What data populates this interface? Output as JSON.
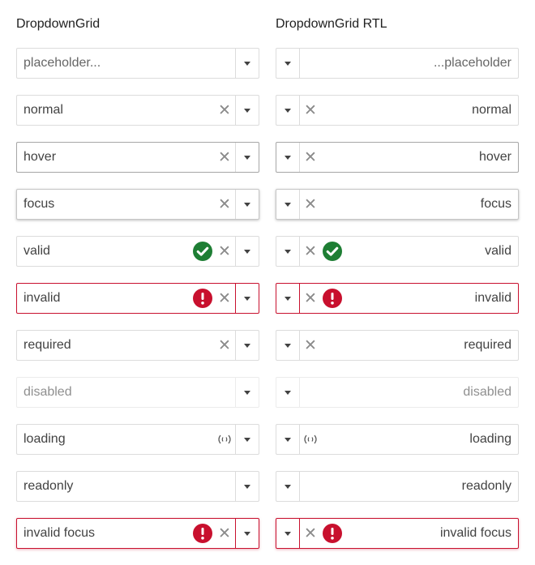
{
  "columns": {
    "ltr": {
      "title": "DropdownGrid"
    },
    "rtl": {
      "title": "DropdownGrid RTL"
    }
  },
  "rows": [
    {
      "label": "placeholder...",
      "rtl_label": "...placeholder",
      "state": "placeholder",
      "clear": false,
      "status": null
    },
    {
      "label": "normal",
      "state": "normal",
      "clear": true,
      "status": null
    },
    {
      "label": "hover",
      "state": "hover",
      "clear": true,
      "status": null
    },
    {
      "label": "focus",
      "state": "focus",
      "clear": true,
      "status": null
    },
    {
      "label": "valid",
      "state": "valid",
      "clear": true,
      "status": "valid"
    },
    {
      "label": "invalid",
      "state": "invalid",
      "clear": true,
      "status": "invalid"
    },
    {
      "label": "required",
      "state": "required",
      "clear": true,
      "status": null
    },
    {
      "label": "disabled",
      "state": "disabled",
      "clear": false,
      "status": null
    },
    {
      "label": "loading",
      "state": "loading",
      "clear": false,
      "status": "loading"
    },
    {
      "label": "readonly",
      "state": "readonly",
      "clear": false,
      "status": null
    },
    {
      "label": "invalid focus",
      "state": "invalid-focus",
      "clear": true,
      "status": "invalid"
    }
  ],
  "icons": {
    "clear": "clear-x-icon",
    "toggle": "caret-down-icon",
    "valid": "check-circle-icon",
    "invalid": "exclamation-circle-icon",
    "loading": "loading-spinner-icon"
  },
  "colors": {
    "valid": "#1e7e34",
    "invalid": "#c8102e",
    "border": "#dcdcdc",
    "text": "#424242"
  }
}
